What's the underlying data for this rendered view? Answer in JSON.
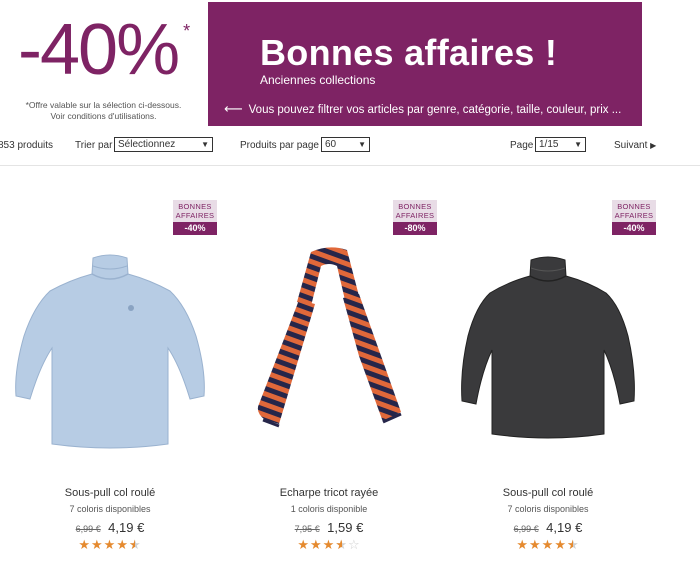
{
  "banner": {
    "discount": "-40%",
    "asterisk": "*",
    "note_line1": "*Offre valable sur la sélection ci-dessous.",
    "note_line2": "Voir conditions d'utilisations.",
    "title": "Bonnes affaires !",
    "subtitle": "Anciennes collections",
    "filter_hint": "Vous pouvez filtrer vos articles par genre, catégorie, taille, couleur, prix ...",
    "accent_color": "#7e2364"
  },
  "toolbar": {
    "count": "853 produits",
    "sort_label": "Trier par",
    "sort_value": "Sélectionnez",
    "per_page_label": "Produits par page",
    "per_page_value": "60",
    "page_label": "Page",
    "page_value": "1/15",
    "next_label": "Suivant"
  },
  "products": [
    {
      "badge_line1": "BONNES",
      "badge_line2": "AFFAIRES",
      "badge_discount": "-40%",
      "name": "Sous-pull col roulé",
      "colors": "7 coloris disponibles",
      "old_price": "6,99 €",
      "new_price": "4,19 €",
      "rating": 4.5,
      "image": "light-blue-turtleneck"
    },
    {
      "badge_line1": "BONNES",
      "badge_line2": "AFFAIRES",
      "badge_discount": "-80%",
      "name": "Echarpe tricot rayée",
      "colors": "1 coloris disponible",
      "old_price": "7,95 €",
      "new_price": "1,59 €",
      "rating": 3.5,
      "image": "striped-scarf"
    },
    {
      "badge_line1": "BONNES",
      "badge_line2": "AFFAIRES",
      "badge_discount": "-40%",
      "name": "Sous-pull col roulé",
      "colors": "7 coloris disponibles",
      "old_price": "6,99 €",
      "new_price": "4,19 €",
      "rating": 4.5,
      "image": "black-turtleneck"
    }
  ]
}
